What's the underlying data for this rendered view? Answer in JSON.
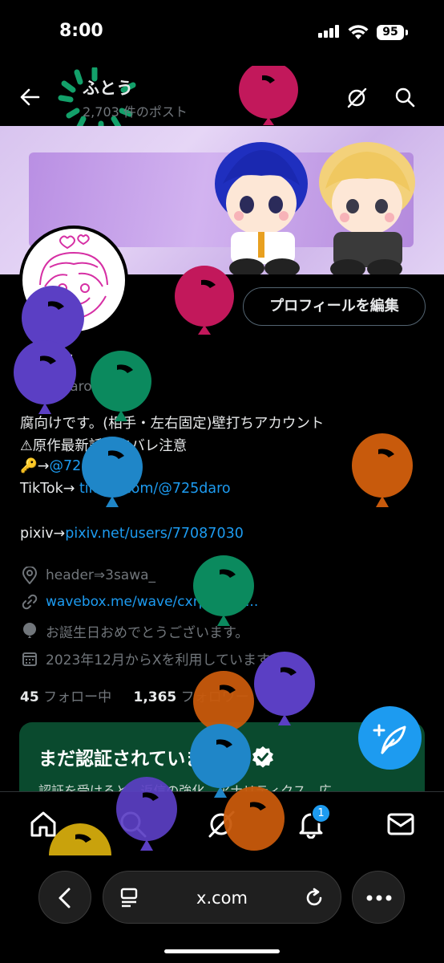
{
  "status_bar": {
    "time": "8:00",
    "battery": "95"
  },
  "header": {
    "name": "ふとう",
    "post_count": "2,703 件のポスト"
  },
  "profile": {
    "edit_button": "プロフィールを編集",
    "display_name": "ふとう",
    "handle": "@725daro",
    "bio_lines": [
      "腐向けです。(相手・左右固定)壁打ちアカウント",
      "⚠原作最新話ネタバレ注意"
    ],
    "sub_account_prefix": "🔑→",
    "sub_account": "@725sabu",
    "tiktok_prefix": "TikTok→ ",
    "tiktok_link": "tiktok.com/@725daro",
    "pixiv_prefix": "pixiv→",
    "pixiv_link": "pixiv.net/users/77087030",
    "location": "header⇒3sawa_",
    "website": "wavebox.me/wave/cxrp1padl...",
    "birthday": "お誕生日おめでとうございます。",
    "joined": "2023年12月からXを利用しています",
    "following_count": "45",
    "following_label": "フォロー中",
    "followers_count": "1,365",
    "followers_label": "フォロワー"
  },
  "verify_card": {
    "title": "まだ認証されていません",
    "description": "認証を受けると、返信の強化、アナリティクス、広"
  },
  "bottom_nav": {
    "notification_badge": "1"
  },
  "browser": {
    "url": "x.com"
  },
  "colors": {
    "accent": "#1d9bf0",
    "verify_card_bg": "#0a4a2e",
    "balloon_magenta": "#c2185b",
    "balloon_purple": "#5b3fc4",
    "balloon_green": "#0b8a5e",
    "balloon_orange": "#c85a0c",
    "balloon_blue": "#1f86c8",
    "balloon_yellow": "#c9a20c"
  }
}
